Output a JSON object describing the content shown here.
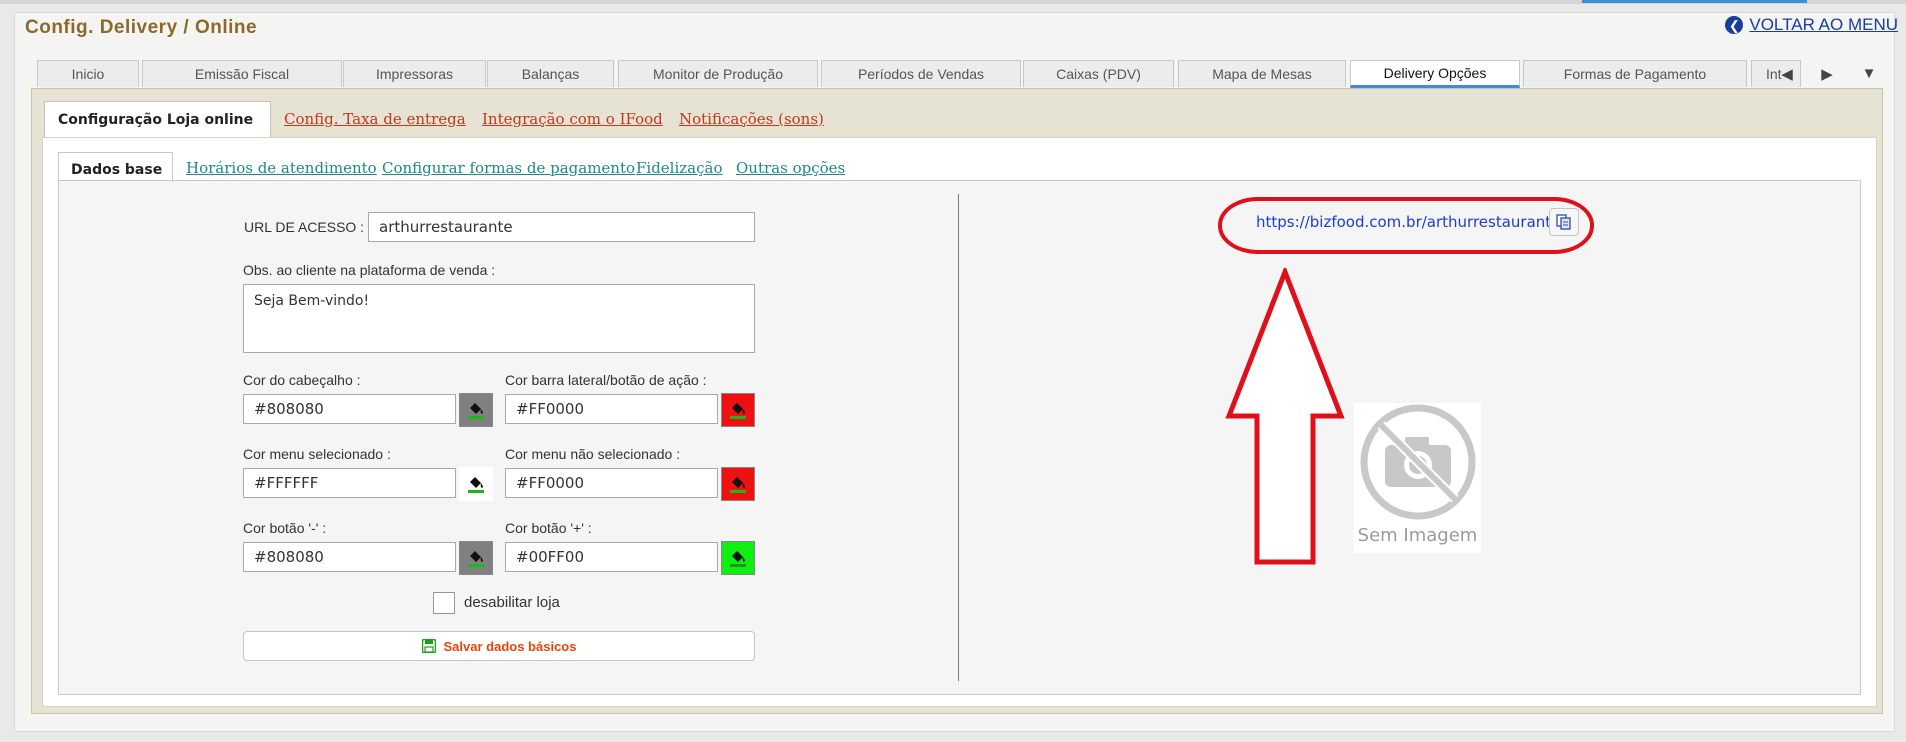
{
  "app": {
    "title": "Config. Delivery / Online",
    "back_label": "VOLTAR AO MENU",
    "accent_color": "#3b8fd0",
    "title_color": "#8a6a2a"
  },
  "main_tabs": [
    {
      "label": "Inicio",
      "active": false
    },
    {
      "label": "Emissão Fiscal",
      "active": false
    },
    {
      "label": "Impressoras",
      "active": false
    },
    {
      "label": "Balanças",
      "active": false
    },
    {
      "label": "Monitor de Produção",
      "active": false
    },
    {
      "label": "Períodos de Vendas",
      "active": false
    },
    {
      "label": "Caixas (PDV)",
      "active": false
    },
    {
      "label": "Mapa de Mesas",
      "active": false
    },
    {
      "label": "Delivery Opções",
      "active": true
    },
    {
      "label": "Formas de Pagamento",
      "active": false
    },
    {
      "label": "Int",
      "active": false
    }
  ],
  "sub_tabs": [
    {
      "label": "Configuração Loja online",
      "active": true
    },
    {
      "label": "Config. Taxa de entrega",
      "active": false
    },
    {
      "label": "Integração com o IFood",
      "active": false
    },
    {
      "label": "Notificações (sons)",
      "active": false
    }
  ],
  "inner_tabs": [
    {
      "label": "Dados base",
      "active": true
    },
    {
      "label": "Horários de atendimento",
      "active": false
    },
    {
      "label": "Configurar formas de pagamento",
      "active": false
    },
    {
      "label": "Fidelização",
      "active": false
    },
    {
      "label": "Outras opções",
      "active": false
    }
  ],
  "form": {
    "url_label": "URL DE ACESSO :",
    "url_value": "arthurrestaurante",
    "obs_label": "Obs. ao cliente na plataforma de venda :",
    "obs_value": "Seja Bem-vindo!",
    "colors": [
      {
        "label": "Cor do cabeçalho :",
        "value": "#808080",
        "swatch": "#808080"
      },
      {
        "label": "Cor barra lateral/botão de ação :",
        "value": "#FF0000",
        "swatch": "#ee1111"
      },
      {
        "label": "Cor menu selecionado :",
        "value": "#FFFFFF",
        "swatch": "#ffffff"
      },
      {
        "label": "Cor menu não selecionado :",
        "value": "#FF0000",
        "swatch": "#ee1111"
      },
      {
        "label": "Cor botão '-' :",
        "value": "#808080",
        "swatch": "#808080"
      },
      {
        "label": "Cor botão '+' :",
        "value": "#00FF00",
        "swatch": "#11ee11"
      }
    ],
    "disable_label": "desabilitar loja",
    "disable_checked": false,
    "save_label": "Salvar dados básicos"
  },
  "preview": {
    "url": "https://bizfood.com.br/arthurrestaurante",
    "no_image_label": "Sem Imagem",
    "highlight_color": "#e0101a"
  }
}
